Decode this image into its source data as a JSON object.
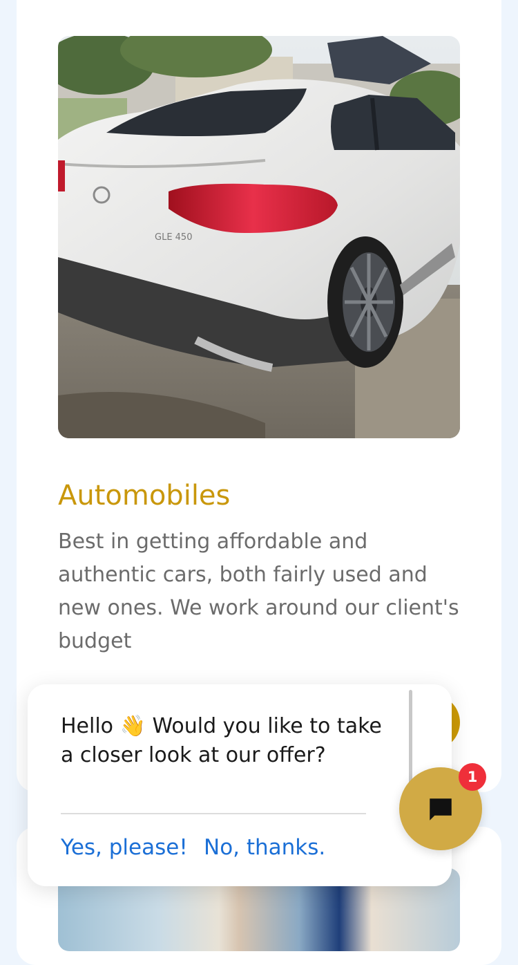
{
  "service": {
    "image_alt": "White Mercedes GLE 450 coupe rear view",
    "title": "Automobiles",
    "description": "Best in getting affordable and authentic cars, both fairly used and new ones. We work around our client's budget",
    "accent_color": "#c9970b"
  },
  "popup": {
    "message": "Hello 👋 Would you like to take a closer look at our offer?",
    "yes_label": "Yes, please!",
    "no_label": "No, thanks.",
    "link_color": "#1b6fd6"
  },
  "chat": {
    "icon": "chat-bubble-icon",
    "badge_count": "1",
    "button_color": "#d1aa45",
    "badge_color": "#ef2f3a"
  },
  "car": {
    "badge_text": "GLE 450"
  }
}
